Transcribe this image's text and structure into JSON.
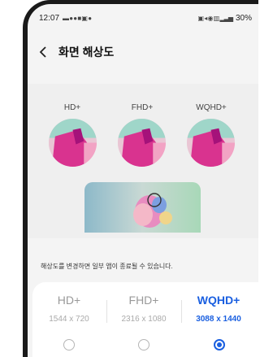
{
  "status_bar": {
    "time": "12:07",
    "left_icons": [
      "message-icon",
      "app-icon",
      "app-icon",
      "gallery-icon",
      "calendar-icon",
      "chat-icon"
    ],
    "right_icons": [
      "vibrate-icon",
      "mute-icon",
      "wifi-icon",
      "signal-icon"
    ],
    "battery": "30%"
  },
  "header": {
    "title": "화면 해상도"
  },
  "preview": {
    "labels": [
      "HD+",
      "FHD+",
      "WQHD+"
    ]
  },
  "notice": "해상도를 변경하면 일부 앱이 종료될 수 있습니다.",
  "options": [
    {
      "name": "HD+",
      "size": "1544 x 720",
      "selected": false
    },
    {
      "name": "FHD+",
      "size": "2316 x 1080",
      "selected": false
    },
    {
      "name": "WQHD+",
      "size": "3088 x 1440",
      "selected": true
    }
  ],
  "colors": {
    "accent": "#1a5fe0",
    "background": "#f4f4f4"
  }
}
